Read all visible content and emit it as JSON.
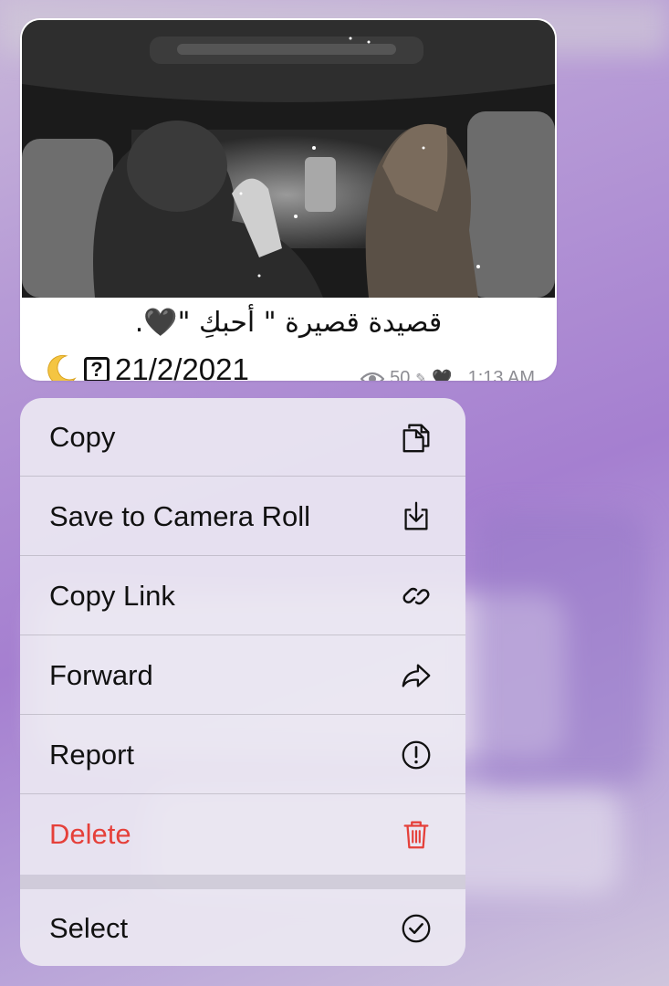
{
  "message": {
    "caption": "قصيدة قصيرة \" أحبكِ \"🖤.",
    "date_text": "21/2/2021",
    "date_icon": "?",
    "moon_icon": "crescent-moon-icon",
    "views": "50",
    "edited_marker": "✎",
    "heart": "🖤",
    "time": ", 1:13 AM"
  },
  "menu": {
    "items": [
      {
        "label": "Copy",
        "icon": "copy-icon"
      },
      {
        "label": "Save to Camera Roll",
        "icon": "save-download-icon"
      },
      {
        "label": "Copy Link",
        "icon": "link-icon"
      },
      {
        "label": "Forward",
        "icon": "forward-arrow-icon"
      },
      {
        "label": "Report",
        "icon": "exclamation-circle-icon"
      },
      {
        "label": "Delete",
        "icon": "trash-icon"
      },
      {
        "label": "Select",
        "icon": "checkmark-circle-icon"
      }
    ],
    "colors": {
      "delete": "#e5403a",
      "text": "#111111"
    }
  }
}
